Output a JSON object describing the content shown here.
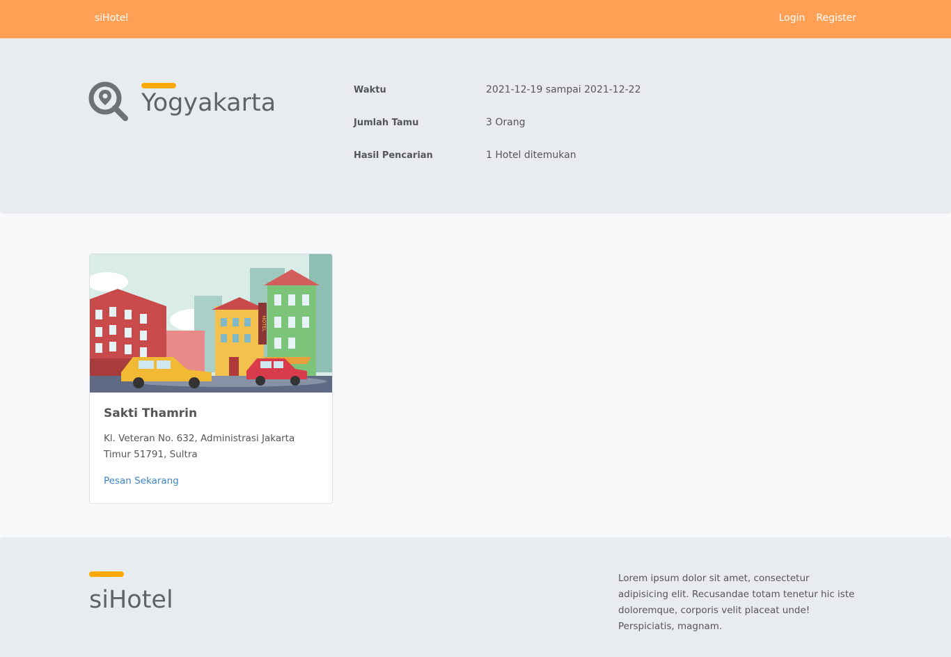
{
  "navbar": {
    "brand": "siHotel",
    "login": "Login",
    "register": "Register"
  },
  "hero": {
    "icon": "location-search-icon",
    "title": "Yogyakarta",
    "info": [
      {
        "label": "Waktu",
        "value": "2021-12-19 sampai 2021-12-22"
      },
      {
        "label": "Jumlah Tamu",
        "value": "3 Orang"
      },
      {
        "label": "Hasil Pencarian",
        "value": "1 Hotel ditemukan"
      }
    ]
  },
  "results": [
    {
      "name": "Sakti Thamrin",
      "address": "Kl. Veteran No. 632, Administrasi Jakarta Timur 51791, Sultra",
      "cta": "Pesan Sekarang",
      "sign_text": "HOTEL"
    }
  ],
  "footer": {
    "brand": "siHotel",
    "text": "Lorem ipsum dolor sit amet, consectetur adipisicing elit. Recusandae totam tenetur hic iste doloremque, corporis velit placeat unde! Perspiciatis, magnam."
  },
  "colors": {
    "navbar": "#ffa055",
    "accent": "#ffa807",
    "panel": "#e9ecef",
    "link": "#3a86c8"
  }
}
